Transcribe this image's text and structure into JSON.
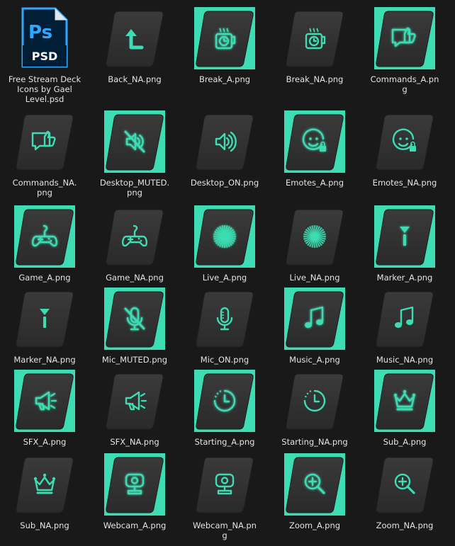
{
  "files": [
    {
      "name": "Free Stream Deck\nIcons by Gael\nLevel.psd",
      "type": "psd",
      "psd_letters": "Ps",
      "psd_ext": "PSD"
    },
    {
      "name": "Back_NA.png",
      "icon": "back",
      "active": false
    },
    {
      "name": "Break_A.png",
      "icon": "break",
      "active": true
    },
    {
      "name": "Break_NA.png",
      "icon": "break",
      "active": false
    },
    {
      "name": "Commands_A.pn\ng",
      "icon": "commands",
      "active": true
    },
    {
      "name": "Commands_NA.\npng",
      "icon": "commands",
      "active": false
    },
    {
      "name": "Desktop_MUTED.\npng",
      "icon": "desktop-muted",
      "active": true
    },
    {
      "name": "Desktop_ON.png",
      "icon": "desktop-on",
      "active": false
    },
    {
      "name": "Emotes_A.png",
      "icon": "emotes",
      "active": true
    },
    {
      "name": "Emotes_NA.png",
      "icon": "emotes",
      "active": false
    },
    {
      "name": "Game_A.png",
      "icon": "game",
      "active": true
    },
    {
      "name": "Game_NA.png",
      "icon": "game",
      "active": false
    },
    {
      "name": "Live_A.png",
      "icon": "live",
      "active": true
    },
    {
      "name": "Live_NA.png",
      "icon": "live",
      "active": false
    },
    {
      "name": "Marker_A.png",
      "icon": "marker",
      "active": true
    },
    {
      "name": "Marker_NA.png",
      "icon": "marker",
      "active": false
    },
    {
      "name": "Mic_MUTED.png",
      "icon": "mic-muted",
      "active": true
    },
    {
      "name": "Mic_ON.png",
      "icon": "mic-on",
      "active": false
    },
    {
      "name": "Music_A.png",
      "icon": "music",
      "active": true
    },
    {
      "name": "Music_NA.png",
      "icon": "music",
      "active": false
    },
    {
      "name": "SFX_A.png",
      "icon": "sfx",
      "active": true
    },
    {
      "name": "SFX_NA.png",
      "icon": "sfx",
      "active": false
    },
    {
      "name": "Starting_A.png",
      "icon": "starting",
      "active": true
    },
    {
      "name": "Starting_NA.png",
      "icon": "starting",
      "active": false
    },
    {
      "name": "Sub_A.png",
      "icon": "sub",
      "active": true
    },
    {
      "name": "Sub_NA.png",
      "icon": "sub",
      "active": false
    },
    {
      "name": "Webcam_A.png",
      "icon": "webcam",
      "active": true
    },
    {
      "name": "Webcam_NA.pn\ng",
      "icon": "webcam",
      "active": false
    },
    {
      "name": "Zoom_A.png",
      "icon": "zoom",
      "active": true
    },
    {
      "name": "Zoom_NA.png",
      "icon": "zoom",
      "active": false
    }
  ],
  "colors": {
    "background": "#191919",
    "accent": "#3ddcb2",
    "tile": "#333333",
    "psd_blue": "#001e36",
    "psd_accent": "#31a8ff"
  }
}
